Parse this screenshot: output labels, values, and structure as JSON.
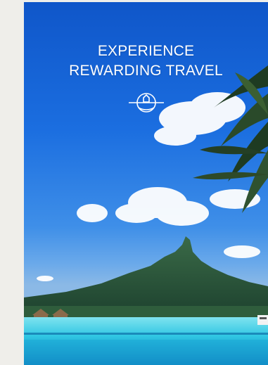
{
  "hero": {
    "headline_line1": "EXPERIENCE",
    "headline_line2": "REWARDING TRAVEL",
    "emblem_icon": "compass-emblem-icon"
  },
  "colors": {
    "background": "#efeeea",
    "sky_top": "#0f56c9",
    "sky_bottom": "#8bb9e6",
    "lagoon": "#29c4e0",
    "mountain": "#2f5a3a",
    "text": "#ffffff"
  }
}
